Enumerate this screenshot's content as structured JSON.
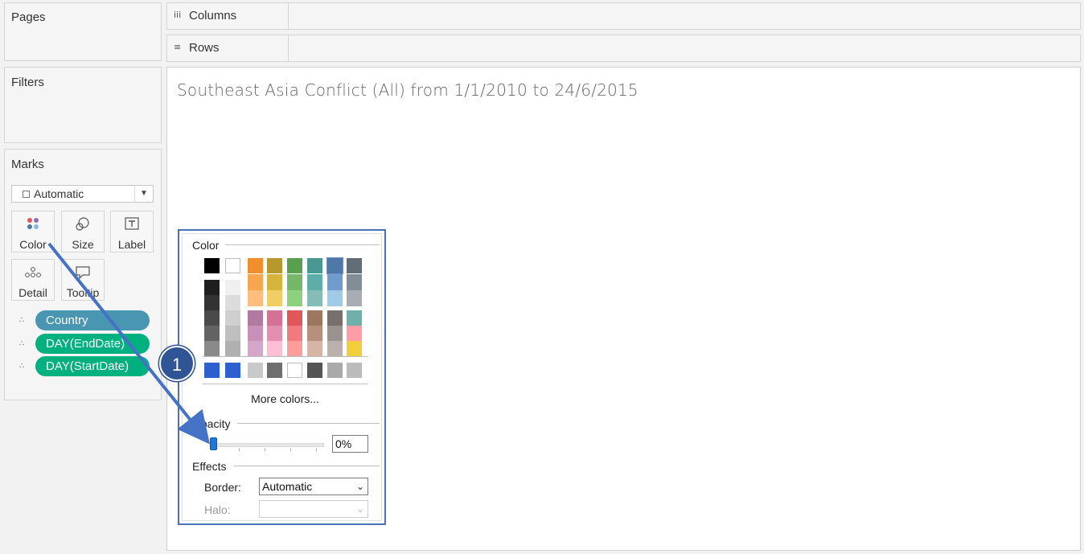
{
  "cards": {
    "pages": "Pages",
    "filters": "Filters",
    "marks": "Marks"
  },
  "shelves": {
    "columns": {
      "icon": "iii",
      "label": "Columns"
    },
    "rows": {
      "icon": "≡",
      "label": "Rows"
    }
  },
  "view": {
    "title": "Southeast Asia Conflict (All) from 1/1/2010 to 24/6/2015"
  },
  "marks": {
    "type": "Automatic",
    "buttons": [
      "Color",
      "Size",
      "Label",
      "Detail",
      "Tooltip"
    ],
    "pills": [
      {
        "label": "Country",
        "color": "#4996b2"
      },
      {
        "label": "DAY(EndDate)",
        "color": "#00b180"
      },
      {
        "label": "DAY(StartDate)",
        "color": "#00b180"
      }
    ]
  },
  "color_popup": {
    "color_header": "Color",
    "more_colors": "More colors...",
    "opacity_header": "Opacity",
    "opacity_value": "0%",
    "opacity_level": 0,
    "effects_header": "Effects",
    "border_label": "Border:",
    "border_value": "Automatic",
    "halo_label": "Halo:",
    "halo_value": "",
    "selected_color": "#4e79a7"
  },
  "annotation": {
    "step": "1"
  }
}
